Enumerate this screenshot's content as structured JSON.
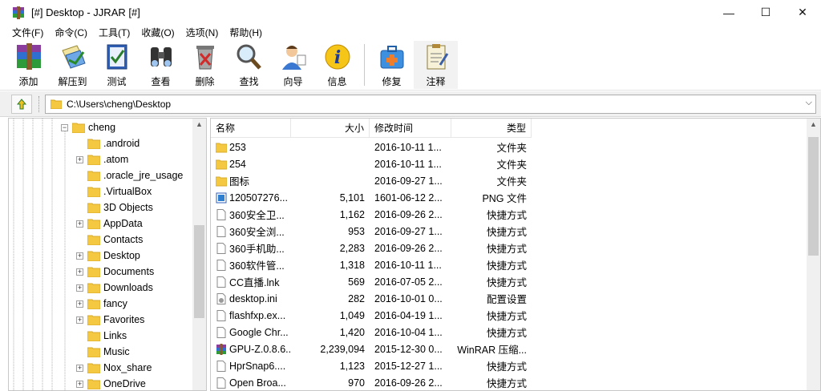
{
  "window": {
    "title": "[#] Desktop - JJRAR [#]",
    "minimize": "—",
    "maximize": "☐",
    "close": "✕"
  },
  "menu": [
    "文件(F)",
    "命令(C)",
    "工具(T)",
    "收藏(O)",
    "选项(N)",
    "帮助(H)"
  ],
  "toolbar": [
    {
      "label": "添加",
      "icon": "add-archive-icon"
    },
    {
      "label": "解压到",
      "icon": "extract-icon"
    },
    {
      "label": "测试",
      "icon": "test-icon"
    },
    {
      "label": "查看",
      "icon": "view-binoculars-icon"
    },
    {
      "label": "删除",
      "icon": "delete-icon"
    },
    {
      "label": "查找",
      "icon": "find-magnifier-icon"
    },
    {
      "label": "向导",
      "icon": "wizard-icon"
    },
    {
      "label": "信息",
      "icon": "info-icon"
    },
    {
      "label": "修复",
      "icon": "repair-kit-icon"
    },
    {
      "label": "注释",
      "icon": "comment-icon"
    }
  ],
  "address": {
    "path": "C:\\Users\\cheng\\Desktop"
  },
  "tree": {
    "parent": {
      "label": "cheng",
      "expanded": true
    },
    "children": [
      {
        "label": ".android",
        "expander": false
      },
      {
        "label": ".atom",
        "expander": true
      },
      {
        "label": ".oracle_jre_usage",
        "expander": false
      },
      {
        "label": ".VirtualBox",
        "expander": false
      },
      {
        "label": "3D Objects",
        "expander": false
      },
      {
        "label": "AppData",
        "expander": true
      },
      {
        "label": "Contacts",
        "expander": false
      },
      {
        "label": "Desktop",
        "expander": true
      },
      {
        "label": "Documents",
        "expander": true
      },
      {
        "label": "Downloads",
        "expander": true
      },
      {
        "label": "fancy",
        "expander": true
      },
      {
        "label": "Favorites",
        "expander": true
      },
      {
        "label": "Links",
        "expander": false
      },
      {
        "label": "Music",
        "expander": false
      },
      {
        "label": "Nox_share",
        "expander": true
      },
      {
        "label": "OneDrive",
        "expander": true
      }
    ]
  },
  "list": {
    "columns": {
      "name": "名称",
      "size": "大小",
      "date": "修改时间",
      "type": "类型"
    },
    "rows": [
      {
        "name": "253",
        "size": "",
        "date": "2016-10-11 1...",
        "type": "文件夹",
        "icon": "folder"
      },
      {
        "name": "254",
        "size": "",
        "date": "2016-10-11 1...",
        "type": "文件夹",
        "icon": "folder"
      },
      {
        "name": "图标",
        "size": "",
        "date": "2016-09-27 1...",
        "type": "文件夹",
        "icon": "folder"
      },
      {
        "name": "120507276...",
        "size": "5,101",
        "date": "1601-06-12 2...",
        "type": "PNG 文件",
        "icon": "image"
      },
      {
        "name": "360安全卫...",
        "size": "1,162",
        "date": "2016-09-26 2...",
        "type": "快捷方式",
        "icon": "file"
      },
      {
        "name": "360安全浏...",
        "size": "953",
        "date": "2016-09-27 1...",
        "type": "快捷方式",
        "icon": "file"
      },
      {
        "name": "360手机助...",
        "size": "2,283",
        "date": "2016-09-26 2...",
        "type": "快捷方式",
        "icon": "file"
      },
      {
        "name": "360软件管...",
        "size": "1,318",
        "date": "2016-10-11 1...",
        "type": "快捷方式",
        "icon": "file"
      },
      {
        "name": "CC直播.lnk",
        "size": "569",
        "date": "2016-07-05 2...",
        "type": "快捷方式",
        "icon": "file"
      },
      {
        "name": "desktop.ini",
        "size": "282",
        "date": "2016-10-01 0...",
        "type": "配置设置",
        "icon": "settings"
      },
      {
        "name": "flashfxp.ex...",
        "size": "1,049",
        "date": "2016-04-19 1...",
        "type": "快捷方式",
        "icon": "file"
      },
      {
        "name": "Google Chr...",
        "size": "1,420",
        "date": "2016-10-04 1...",
        "type": "快捷方式",
        "icon": "file"
      },
      {
        "name": "GPU-Z.0.8.6...",
        "size": "2,239,094",
        "date": "2015-12-30 0...",
        "type": "WinRAR 压缩...",
        "icon": "rar"
      },
      {
        "name": "HprSnap6....",
        "size": "1,123",
        "date": "2015-12-27 1...",
        "type": "快捷方式",
        "icon": "file"
      },
      {
        "name": "Open Broa...",
        "size": "970",
        "date": "2016-09-26 2...",
        "type": "快捷方式",
        "icon": "file"
      }
    ]
  },
  "colors": {
    "folder": "#f5c842",
    "chrome_bg": "#f0f0f0",
    "border": "#c8c8c8"
  }
}
